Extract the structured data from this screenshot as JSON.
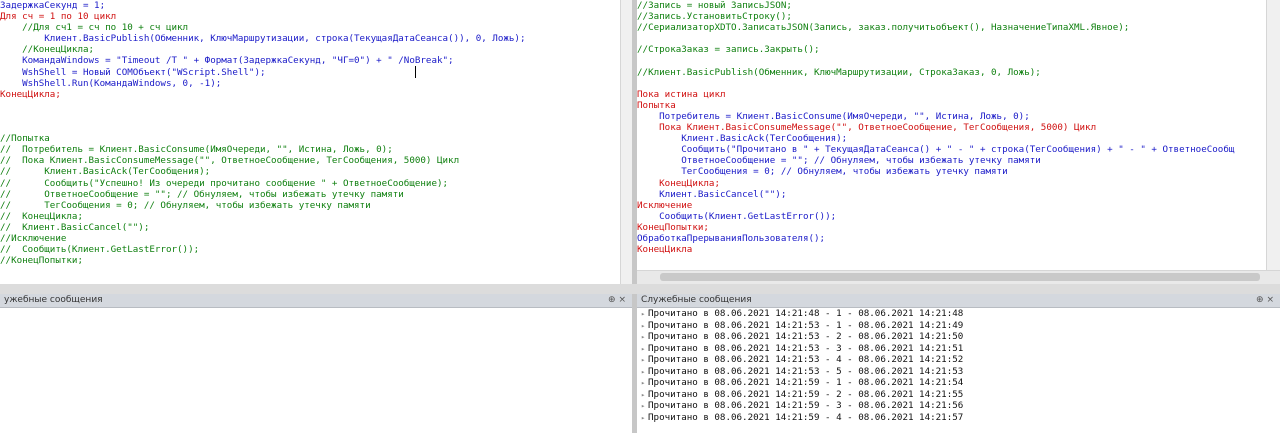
{
  "left_editor": {
    "lines": [
      {
        "text": "ЗадержкаСекунд = 1;",
        "color": "blue"
      },
      {
        "text": "Для сч = 1 по 10 цикл",
        "color": "red"
      },
      {
        "text": "    //Для сч1 = сч по 10 + сч цикл",
        "color": "green"
      },
      {
        "text": "        Клиент.BasicPublish(Обменник, КлючМаршрутизации, строка(ТекущаяДатаСеанса()), 0, Ложь);",
        "color": "blue"
      },
      {
        "text": "    //КонецЦикла;",
        "color": "green"
      },
      {
        "text": "    КомандаWindows = \"Timeout /T \" + Формат(ЗадержкаСекунд, \"ЧГ=0\") + \" /NoBreak\";",
        "color": "blue"
      },
      {
        "text": "    WshShell = Новый COMОбъект(\"WScript.Shell\");",
        "color": "blue"
      },
      {
        "text": "    WshShell.Run(КомандаWindows, 0, -1);",
        "color": "blue"
      },
      {
        "text": "КонецЦикла;",
        "color": "red"
      },
      {
        "text": "",
        "color": "black"
      },
      {
        "text": "",
        "color": "black"
      },
      {
        "text": "",
        "color": "black"
      },
      {
        "text": "//Попытка",
        "color": "green"
      },
      {
        "text": "//  Потребитель = Клиент.BasicConsume(ИмяОчереди, \"\", Истина, Ложь, 0);",
        "color": "green"
      },
      {
        "text": "//  Пока Клиент.BasicConsumeMessage(\"\", ОтветноеСообщение, ТегСообщения, 5000) Цикл",
        "color": "green"
      },
      {
        "text": "//      Клиент.BasicAck(ТегСообщения);",
        "color": "green"
      },
      {
        "text": "//      Сообщить(\"Успешно! Из очереди прочитано сообщение \" + ОтветноеСообщение);",
        "color": "green"
      },
      {
        "text": "//      ОтветноеСообщение = \"\"; // Обнуляем, чтобы избежать утечку памяти",
        "color": "green"
      },
      {
        "text": "//      ТегСообщения = 0; // Обнуляем, чтобы избежать утечку памяти",
        "color": "green"
      },
      {
        "text": "//  КонецЦикла;",
        "color": "green"
      },
      {
        "text": "//  Клиент.BasicCancel(\"\");",
        "color": "green"
      },
      {
        "text": "//Исключение",
        "color": "green"
      },
      {
        "text": "//  Сообщить(Клиент.GetLastError());",
        "color": "green"
      },
      {
        "text": "//КонецПопытки;",
        "color": "green"
      }
    ]
  },
  "right_editor": {
    "lines": [
      {
        "text": "//Запись = новый ЗаписьJSON;",
        "color": "green"
      },
      {
        "text": "//Запись.УстановитьСтроку();",
        "color": "green"
      },
      {
        "text": "//СериализаторXDTO.ЗаписатьJSON(Запись, заказ.получитьобъект(), НазначениеТипаXML.Явное);",
        "color": "green"
      },
      {
        "text": "",
        "color": "black"
      },
      {
        "text": "//СтрокаЗаказ = запись.Закрыть();",
        "color": "green"
      },
      {
        "text": "",
        "color": "black"
      },
      {
        "text": "//Клиент.BasicPublish(Обменник, КлючМаршрутизации, СтрокаЗаказ, 0, Ложь);",
        "color": "green"
      },
      {
        "text": "",
        "color": "black"
      },
      {
        "text": "Пока истина цикл",
        "color": "red"
      },
      {
        "text": "Попытка",
        "color": "red"
      },
      {
        "text": "    Потребитель = Клиент.BasicConsume(ИмяОчереди, \"\", Истина, Ложь, 0);",
        "color": "blue"
      },
      {
        "text": "    Пока Клиент.BasicConsumeMessage(\"\", ОтветноеСообщение, ТегСообщения, 5000) Цикл",
        "color": "red"
      },
      {
        "text": "        Клиент.BasicAck(ТегСообщения);",
        "color": "blue"
      },
      {
        "text": "        Сообщить(\"Прочитано в \" + ТекущаяДатаСеанса() + \" - \" + строка(ТегСообщения) + \" - \" + ОтветноеСообщ",
        "color": "blue"
      },
      {
        "text": "        ОтветноеСообщение = \"\"; // Обнуляем, чтобы избежать утечку памяти",
        "color": "blue"
      },
      {
        "text": "        ТегСообщения = 0; // Обнуляем, чтобы избежать утечку памяти",
        "color": "blue"
      },
      {
        "text": "    КонецЦикла;",
        "color": "red"
      },
      {
        "text": "    Клиент.BasicCancel(\"\");",
        "color": "blue"
      },
      {
        "text": "Исключение",
        "color": "red"
      },
      {
        "text": "    Сообщить(Клиент.GetLastError());",
        "color": "blue"
      },
      {
        "text": "КонецПопытки;",
        "color": "red"
      },
      {
        "text": "ОбработкаПрерыванияПользователя();",
        "color": "blue"
      },
      {
        "text": "КонецЦикла",
        "color": "red"
      }
    ]
  },
  "messages_left": {
    "title": "ужебные сообщения",
    "controls": "⊕ ×"
  },
  "messages_right": {
    "title": "Служебные сообщения",
    "controls": "⊕ ×",
    "items": [
      "Прочитано в 08.06.2021 14:21:48 - 1 - 08.06.2021 14:21:48",
      "Прочитано в 08.06.2021 14:21:53 - 1 - 08.06.2021 14:21:49",
      "Прочитано в 08.06.2021 14:21:53 - 2 - 08.06.2021 14:21:50",
      "Прочитано в 08.06.2021 14:21:53 - 3 - 08.06.2021 14:21:51",
      "Прочитано в 08.06.2021 14:21:53 - 4 - 08.06.2021 14:21:52",
      "Прочитано в 08.06.2021 14:21:53 - 5 - 08.06.2021 14:21:53",
      "Прочитано в 08.06.2021 14:21:59 - 1 - 08.06.2021 14:21:54",
      "Прочитано в 08.06.2021 14:21:59 - 2 - 08.06.2021 14:21:55",
      "Прочитано в 08.06.2021 14:21:59 - 3 - 08.06.2021 14:21:56",
      "Прочитано в 08.06.2021 14:21:59 - 4 - 08.06.2021 14:21:57"
    ]
  },
  "icons": {
    "message_bullet": "triangle-right-icon"
  },
  "colors": {
    "keyword": "#d01010",
    "identifier": "#1a1ac8",
    "comment": "#108010"
  }
}
